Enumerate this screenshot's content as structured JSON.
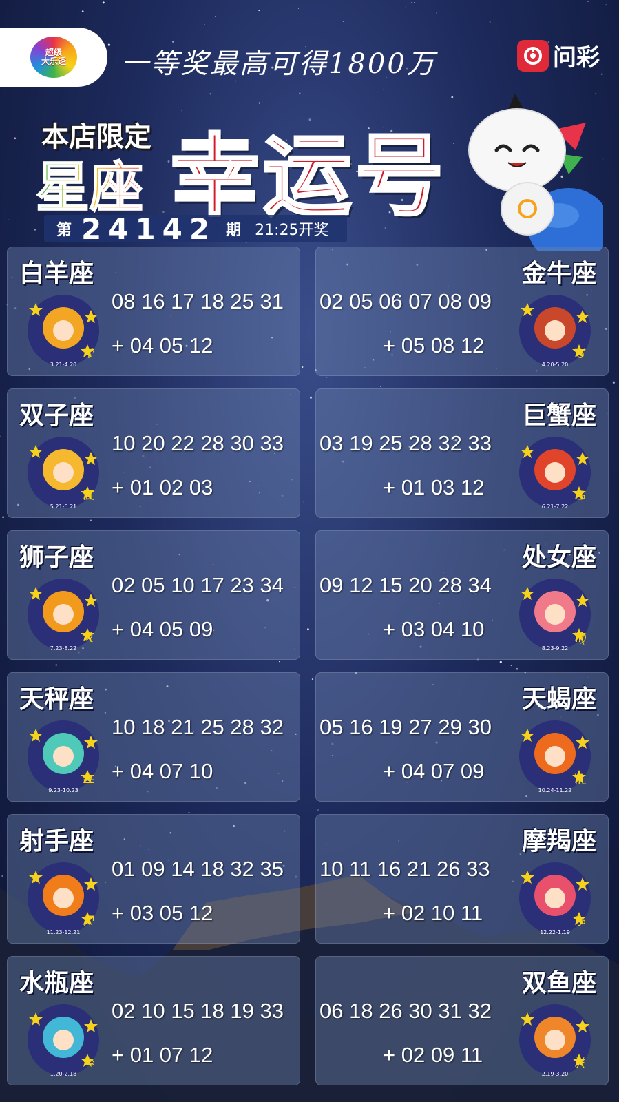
{
  "header": {
    "logo_line1": "超级",
    "logo_line2": "大乐透",
    "slogan": "一等奖最高可得1800万",
    "brand_name": "问彩"
  },
  "headline": {
    "store_limited": "本店限定",
    "zodiac_word": "星座",
    "lucky_word": "幸运号",
    "issue_prefix": "第",
    "issue_number": "24142",
    "issue_suffix": "期",
    "draw_time": "21:25开奖"
  },
  "signs": [
    {
      "name": "白羊座",
      "main": "08 16 17 18 25 31",
      "extra": "+ 04 05 12",
      "dates": "3.21-4.20",
      "color": "#f2a623",
      "icon": "aries-icon",
      "symbol": "♈"
    },
    {
      "name": "金牛座",
      "main": "02 05 06 07 08 09",
      "extra": "+ 05 08 12",
      "dates": "4.20-5.20",
      "color": "#c9482b",
      "icon": "taurus-icon",
      "symbol": "♉"
    },
    {
      "name": "双子座",
      "main": "10 20 22 28 30 33",
      "extra": "+ 01 02 03",
      "dates": "5.21-6.21",
      "color": "#f5b82e",
      "icon": "gemini-icon",
      "symbol": "♊"
    },
    {
      "name": "巨蟹座",
      "main": "03 19 25 28 32 33",
      "extra": "+ 01 03 12",
      "dates": "6.21-7.22",
      "color": "#e0442a",
      "icon": "cancer-icon",
      "symbol": "♋"
    },
    {
      "name": "狮子座",
      "main": "02 05 10 17 23 34",
      "extra": "+ 04 05 09",
      "dates": "7.23-8.22",
      "color": "#f29a1c",
      "icon": "leo-icon",
      "symbol": "♌"
    },
    {
      "name": "处女座",
      "main": "09 12 15 20 28 34",
      "extra": "+ 03 04 10",
      "dates": "8.23-9.22",
      "color": "#f07a8a",
      "icon": "virgo-icon",
      "symbol": "♍"
    },
    {
      "name": "天秤座",
      "main": "10 18 21 25 28 32",
      "extra": "+ 04 07 10",
      "dates": "9.23-10.23",
      "color": "#4fc9b8",
      "icon": "libra-icon",
      "symbol": "♎"
    },
    {
      "name": "天蝎座",
      "main": "05 16 19 27 29 30",
      "extra": "+ 04 07 09",
      "dates": "10.24-11.22",
      "color": "#ee6a1c",
      "icon": "scorpio-icon",
      "symbol": "♏"
    },
    {
      "name": "射手座",
      "main": "01 09 14 18 32 35",
      "extra": "+ 03 05 12",
      "dates": "11.23-12.21",
      "color": "#f07d1a",
      "icon": "sagittarius-icon",
      "symbol": "♐"
    },
    {
      "name": "摩羯座",
      "main": "10 11 16 21 26 33",
      "extra": "+ 02 10 11",
      "dates": "12.22-1.19",
      "color": "#e8506b",
      "icon": "capricorn-icon",
      "symbol": "♑"
    },
    {
      "name": "水瓶座",
      "main": "02 10 15 18 19 33",
      "extra": "+ 01 07 12",
      "dates": "1.20-2.18",
      "color": "#42b8d6",
      "icon": "aquarius-icon",
      "symbol": "♒"
    },
    {
      "name": "双鱼座",
      "main": "06 18 26 30 31 32",
      "extra": "+ 02 09 11",
      "dates": "2.19-3.20",
      "color": "#f0862a",
      "icon": "pisces-icon",
      "symbol": "♓"
    }
  ]
}
